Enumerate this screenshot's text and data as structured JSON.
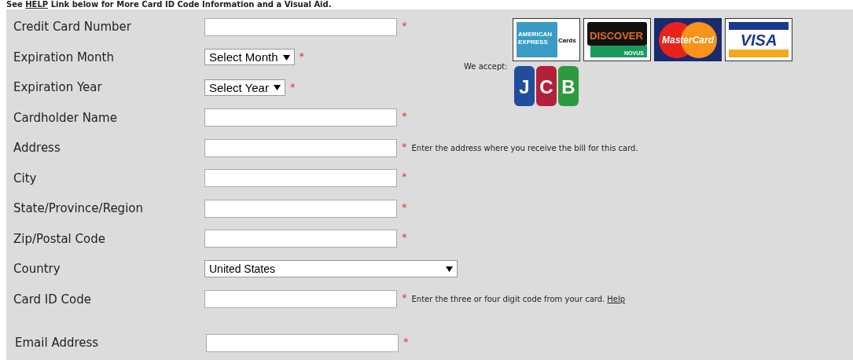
{
  "header_note": {
    "before": "See ",
    "link": "HELP",
    "after": " Link below for More Card ID Code Information and a Visual Aid."
  },
  "card_fields": [
    {
      "kind": "text",
      "label": "Credit Card Number",
      "required": true
    },
    {
      "kind": "select",
      "label": "Expiration Month",
      "value": "Select Month",
      "required": true
    },
    {
      "kind": "select",
      "label": "Expiration Year",
      "value": "Select Year",
      "required": true
    },
    {
      "kind": "text",
      "label": "Cardholder Name",
      "required": true
    },
    {
      "kind": "text",
      "label": "Address",
      "required": true,
      "hint": "Enter the address where you receive the bill for this card."
    },
    {
      "kind": "text",
      "label": "City",
      "required": true
    },
    {
      "kind": "text",
      "label": "State/Province/Region",
      "required": true
    },
    {
      "kind": "text",
      "label": "Zip/Postal Code",
      "required": true
    },
    {
      "kind": "wide-select",
      "label": "Country",
      "value": "United States",
      "required": false
    },
    {
      "kind": "text",
      "label": "Card ID Code",
      "required": true,
      "hint": "Enter the three or four digit code from your card.",
      "link": "Help"
    }
  ],
  "accepted_cards": {
    "label": "We accept:",
    "logos": [
      {
        "kind": "amex",
        "texts": [
          "AMERICAN",
          "EXPRESS",
          "Cards"
        ]
      },
      {
        "kind": "discover",
        "texts": [
          "DISCOVER",
          "NOVUS"
        ]
      },
      {
        "kind": "mastercard",
        "texts": [
          "MasterCard"
        ]
      },
      {
        "kind": "visa",
        "texts": [
          "VISA"
        ]
      },
      {
        "kind": "jcb",
        "texts": [
          "J",
          "C",
          "B"
        ]
      }
    ]
  },
  "contact_fields": [
    {
      "kind": "text",
      "label": "Email Address",
      "required": true
    }
  ],
  "required_mark": "*"
}
